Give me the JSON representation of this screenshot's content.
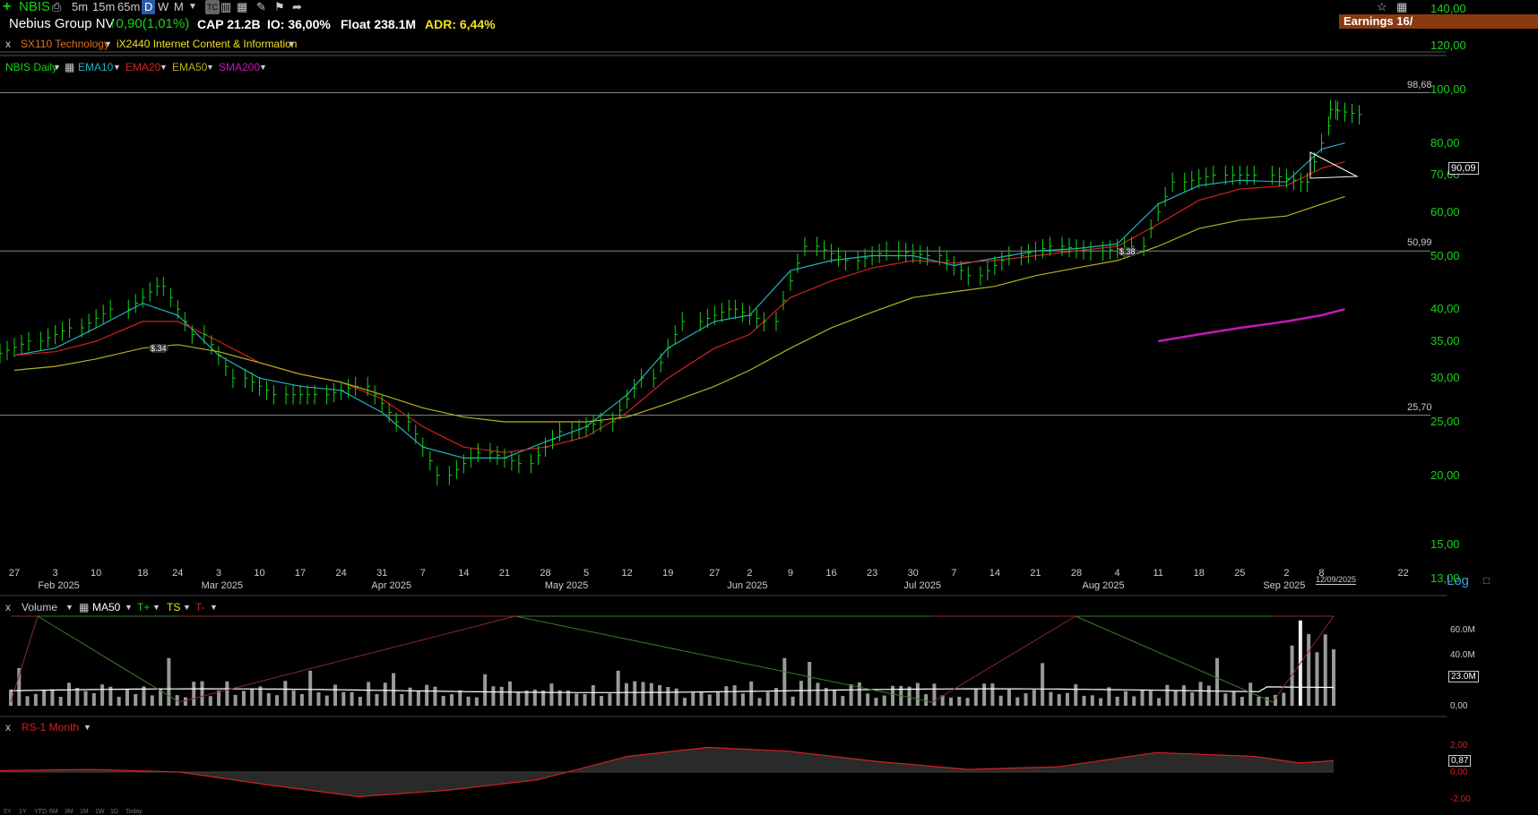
{
  "toolbar": {
    "plus_icon": "plus-icon",
    "ticker": "NBIS",
    "intervals": [
      "5m",
      "15m",
      "65m"
    ],
    "period_d": "D",
    "period_w": "W",
    "period_m": "M",
    "tc_label": "TC"
  },
  "header": {
    "company": "Nebius Group NV",
    "change": "0,90(1,01%)",
    "cap": "CAP 21.2B",
    "io": "IO: 36,00%",
    "float": "Float 238.1M",
    "adr": "ADR: 6,44%",
    "earnings": "Earnings 16/"
  },
  "sectors": {
    "sector": "SX110 Technology",
    "industry": "iX2440 Internet Content & Information"
  },
  "indicators": {
    "main": "NBIS Daily",
    "ema10": "EMA10",
    "ema20": "EMA20",
    "ema50": "EMA50",
    "sma200": "SMA200"
  },
  "colors": {
    "up": "#16d316",
    "ema10": "#1fb3c4",
    "ema20": "#d42020",
    "ema50": "#b8b020",
    "sma200": "#c01ab8",
    "rs": "#d42020"
  },
  "price_axis": {
    "labels": [
      "140,00",
      "120,00",
      "100,00",
      "80,00",
      "70,00",
      "60,00",
      "50,00",
      "40,00",
      "35,00",
      "30,00",
      "25,00",
      "20,00",
      "15,00",
      "13,00"
    ],
    "current": "90,09",
    "log_label": "Log"
  },
  "hlines": [
    {
      "label": "98,68",
      "value": 98.68
    },
    {
      "label": "50,99",
      "value": 50.99
    },
    {
      "label": "25,70",
      "value": 25.7
    }
  ],
  "x_axis": {
    "days": [
      "27",
      "3",
      "10",
      "18",
      "24",
      "3",
      "10",
      "17",
      "24",
      "31",
      "7",
      "14",
      "21",
      "28",
      "5",
      "12",
      "19",
      "27",
      "2",
      "9",
      "16",
      "23",
      "30",
      "7",
      "14",
      "21",
      "28",
      "4",
      "11",
      "18",
      "25",
      "2",
      "8",
      "22"
    ],
    "months": [
      "Feb 2025",
      "Mar 2025",
      "Apr 2025",
      "May 2025",
      "Jun 2025",
      "Jul 2025",
      "Aug 2025",
      "Sep 2025"
    ],
    "cursor_date": "12/09/2025"
  },
  "annotations": [
    "$.34",
    "$.38"
  ],
  "volume_pane": {
    "title": "Volume",
    "ma": "MA50",
    "tplus": "T+",
    "ts": "TS",
    "tminus": "T-",
    "labels": [
      "60.0M",
      "40.0M",
      "0,00"
    ],
    "current": "23.0M"
  },
  "rs_pane": {
    "title": "RS-1 Month",
    "labels": [
      "2,00",
      "0,00",
      "-2,00"
    ],
    "current": "0,87"
  },
  "zoom_buttons": [
    "5Y",
    "1Y",
    "YTD",
    "6M",
    "3M",
    "1M",
    "1W",
    "1D",
    "Today"
  ],
  "chart_data": {
    "type": "line",
    "title": "",
    "yscale": "log",
    "ylim": [
      12,
      150
    ],
    "dates": [
      "2025-01-27",
      "2025-02-03",
      "2025-02-10",
      "2025-02-18",
      "2025-02-24",
      "2025-03-03",
      "2025-03-10",
      "2025-03-17",
      "2025-03-24",
      "2025-03-31",
      "2025-04-07",
      "2025-04-14",
      "2025-04-21",
      "2025-04-28",
      "2025-05-05",
      "2025-05-12",
      "2025-05-19",
      "2025-05-27",
      "2025-06-02",
      "2025-06-09",
      "2025-06-16",
      "2025-06-23",
      "2025-06-30",
      "2025-07-07",
      "2025-07-14",
      "2025-07-21",
      "2025-07-28",
      "2025-08-04",
      "2025-08-11",
      "2025-08-18",
      "2025-08-25",
      "2025-09-02",
      "2025-09-08",
      "2025-09-12"
    ],
    "series": [
      {
        "name": "Close",
        "values": [
          35,
          37,
          40,
          44,
          36,
          30,
          28,
          28,
          29,
          25,
          20,
          22,
          21,
          24,
          25,
          30,
          38,
          40,
          38,
          52,
          49,
          51,
          50,
          46,
          50,
          52,
          51,
          52,
          68,
          70,
          70,
          68,
          92,
          90.09
        ]
      },
      {
        "name": "EMA10",
        "values": [
          33,
          34,
          37,
          41,
          39,
          33,
          30,
          29,
          28.5,
          26,
          22.5,
          21.5,
          21.5,
          23,
          24.5,
          28,
          34,
          38,
          39,
          47,
          49,
          50,
          50,
          48,
          49.5,
          51,
          51.5,
          52.5,
          62,
          67,
          68.5,
          68,
          78,
          80
        ]
      },
      {
        "name": "EMA20",
        "values": [
          33,
          33.5,
          35,
          38,
          38,
          35,
          32,
          30.5,
          29.5,
          27.5,
          24.5,
          22.5,
          22,
          22.5,
          23.5,
          26,
          30,
          34,
          36,
          42,
          45,
          47.5,
          49,
          48.5,
          49,
          50,
          51,
          52,
          57,
          63,
          66,
          67,
          72,
          74
        ]
      },
      {
        "name": "EMA50",
        "values": [
          31,
          31.5,
          32.5,
          34,
          34.5,
          33.5,
          32,
          30.5,
          29.5,
          28,
          26.5,
          25.5,
          25,
          25,
          25,
          25.5,
          27,
          29,
          31,
          34,
          37,
          39.5,
          42,
          43,
          44,
          46,
          47.5,
          49,
          52,
          56,
          58,
          59,
          62,
          64
        ]
      },
      {
        "name": "SMA200",
        "values": [
          null,
          null,
          null,
          null,
          null,
          null,
          null,
          null,
          null,
          null,
          null,
          null,
          null,
          null,
          null,
          null,
          null,
          null,
          null,
          null,
          null,
          null,
          null,
          null,
          null,
          null,
          null,
          null,
          35,
          36,
          37,
          38,
          39,
          40
        ]
      }
    ]
  }
}
